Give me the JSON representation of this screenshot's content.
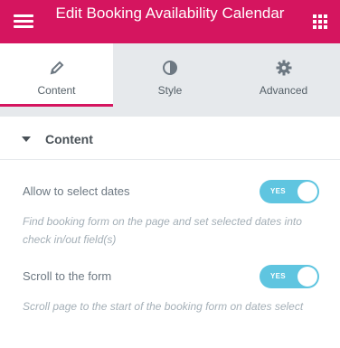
{
  "header": {
    "title": "Edit Booking Availability Calendar",
    "colors": {
      "brand": "#d5155f"
    }
  },
  "tabs": [
    {
      "label": "Content",
      "icon": "pencil-icon",
      "active": true
    },
    {
      "label": "Style",
      "icon": "contrast-icon",
      "active": false
    },
    {
      "label": "Advanced",
      "icon": "gear-icon",
      "active": false
    }
  ],
  "section": {
    "title": "Content",
    "icon": "caret-down-icon"
  },
  "controls": [
    {
      "label": "Allow to select dates",
      "toggle": {
        "state": "YES",
        "on": true
      },
      "description": "Find booking form on the page and set selected dates into check in/out field(s)"
    },
    {
      "label": "Scroll to the form",
      "toggle": {
        "state": "YES",
        "on": true
      },
      "description": "Scroll page to the start of the booking form on dates select"
    }
  ]
}
